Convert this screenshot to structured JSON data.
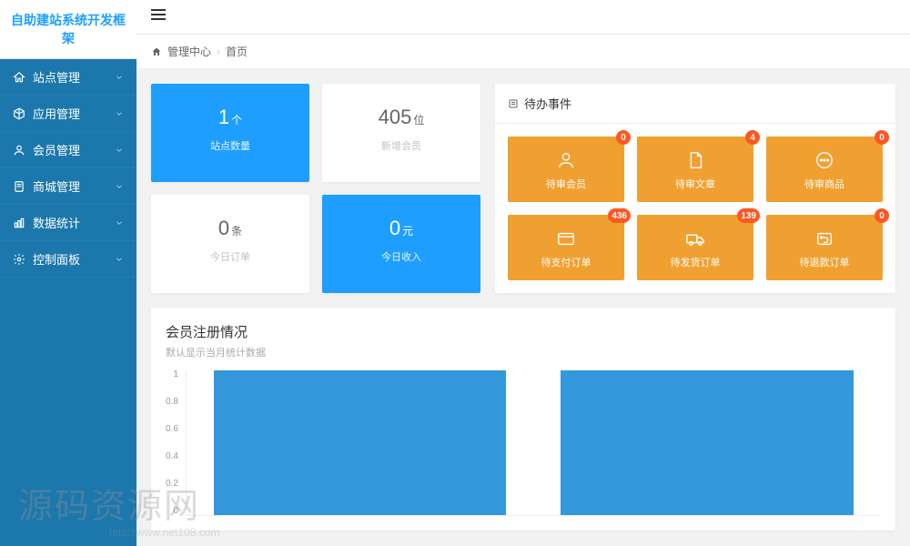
{
  "logo": "自助建站系统开发框架",
  "sidebar": {
    "items": [
      {
        "label": "站点管理",
        "icon": "home"
      },
      {
        "label": "应用管理",
        "icon": "cube"
      },
      {
        "label": "会员管理",
        "icon": "user"
      },
      {
        "label": "商城管理",
        "icon": "doc"
      },
      {
        "label": "数据统计",
        "icon": "chart"
      },
      {
        "label": "控制面板",
        "icon": "gear"
      }
    ]
  },
  "breadcrumb": {
    "root": "管理中心",
    "current": "首页"
  },
  "stats": [
    {
      "value": "1",
      "unit": "个",
      "label": "站点数量",
      "style": "blue"
    },
    {
      "value": "405",
      "unit": "位",
      "label": "新增会员",
      "style": "white"
    },
    {
      "value": "0",
      "unit": "条",
      "label": "今日订单",
      "style": "white"
    },
    {
      "value": "0",
      "unit": "元",
      "label": "今日收入",
      "style": "blue"
    }
  ],
  "todo": {
    "title": "待办事件",
    "items": [
      {
        "label": "待审会员",
        "badge": "0",
        "icon": "person"
      },
      {
        "label": "待审文章",
        "badge": "4",
        "icon": "file"
      },
      {
        "label": "待审商品",
        "badge": "0",
        "icon": "chat"
      },
      {
        "label": "待支付订单",
        "badge": "436",
        "icon": "card"
      },
      {
        "label": "待发货订单",
        "badge": "139",
        "icon": "truck"
      },
      {
        "label": "待退款订单",
        "badge": "0",
        "icon": "refund"
      }
    ]
  },
  "chart": {
    "title": "会员注册情况",
    "subtitle": "默认显示当月统计数据"
  },
  "chart_data": {
    "type": "bar",
    "title": "会员注册情况",
    "subtitle": "默认显示当月统计数据",
    "categories": [
      "(hidden 1)",
      "(hidden 2)"
    ],
    "values": [
      1,
      1
    ],
    "ylabel": "",
    "ylim": [
      0,
      1
    ],
    "yticks": [
      0,
      0.2,
      0.4,
      0.6,
      0.8,
      1
    ]
  },
  "watermark": {
    "text": "源码资源网",
    "url": "http://www.net108.com"
  }
}
